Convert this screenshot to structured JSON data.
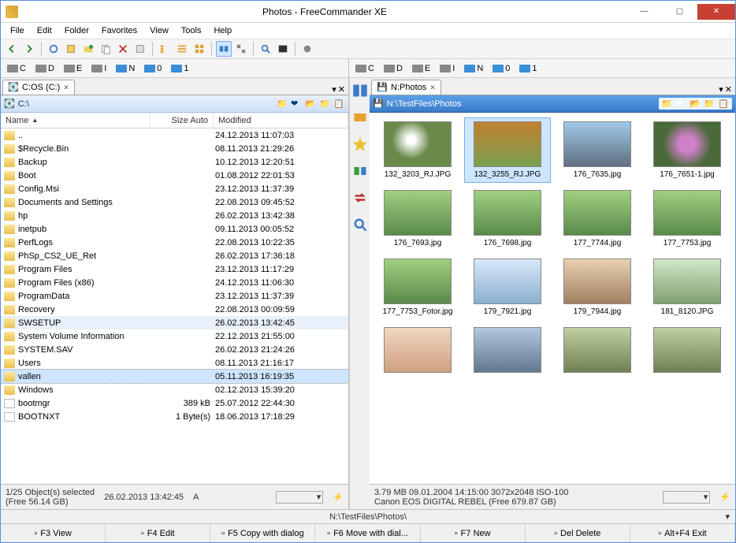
{
  "title": "Photos - FreeCommander XE",
  "menu": [
    "File",
    "Edit",
    "Folder",
    "Favorites",
    "View",
    "Tools",
    "Help"
  ],
  "drives_left": [
    {
      "label": "C",
      "net": false
    },
    {
      "label": "D",
      "net": false
    },
    {
      "label": "E",
      "net": false
    },
    {
      "label": "I",
      "net": false
    },
    {
      "label": "N",
      "net": true
    },
    {
      "label": "0",
      "net": true
    },
    {
      "label": "1",
      "net": true
    }
  ],
  "drives_right": [
    {
      "label": "C",
      "net": false
    },
    {
      "label": "D",
      "net": false
    },
    {
      "label": "E",
      "net": false
    },
    {
      "label": "I",
      "net": false
    },
    {
      "label": "N",
      "net": true
    },
    {
      "label": "0",
      "net": true
    },
    {
      "label": "1",
      "net": true
    }
  ],
  "left": {
    "tab": "C:OS (C:)",
    "path": "C:\\",
    "columns": {
      "name": "Name",
      "size": "Size Auto",
      "modified": "Modified"
    },
    "rows": [
      {
        "icon": "up",
        "name": "..",
        "size": "",
        "mod": "24.12.2013 11:07:03"
      },
      {
        "icon": "folder",
        "name": "$Recycle.Bin",
        "size": "",
        "mod": "08.11.2013 21:29:26"
      },
      {
        "icon": "folder",
        "name": "Backup",
        "size": "",
        "mod": "10.12.2013 12:20:51"
      },
      {
        "icon": "folder",
        "name": "Boot",
        "size": "",
        "mod": "01.08.2012 22:01:53"
      },
      {
        "icon": "folder",
        "name": "Config.Msi",
        "size": "",
        "mod": "23.12.2013 11:37:39"
      },
      {
        "icon": "folder",
        "name": "Documents and Settings",
        "size": "",
        "mod": "22.08.2013 09:45:52"
      },
      {
        "icon": "folder",
        "name": "hp",
        "size": "",
        "mod": "26.02.2013 13:42:38"
      },
      {
        "icon": "folder",
        "name": "inetpub",
        "size": "",
        "mod": "09.11.2013 00:05:52"
      },
      {
        "icon": "folder",
        "name": "PerfLogs",
        "size": "",
        "mod": "22.08.2013 10:22:35"
      },
      {
        "icon": "folder",
        "name": "PhSp_CS2_UE_Ret",
        "size": "",
        "mod": "26.02.2013 17:36:18"
      },
      {
        "icon": "folder",
        "name": "Program Files",
        "size": "",
        "mod": "23.12.2013 11:17:29"
      },
      {
        "icon": "folder",
        "name": "Program Files (x86)",
        "size": "",
        "mod": "24.12.2013 11:06:30"
      },
      {
        "icon": "folder",
        "name": "ProgramData",
        "size": "",
        "mod": "23.12.2013 11:37:39"
      },
      {
        "icon": "folder",
        "name": "Recovery",
        "size": "",
        "mod": "22.08.2013 00:09:59"
      },
      {
        "icon": "folder",
        "name": "SWSETUP",
        "size": "",
        "mod": "26.02.2013 13:42:45",
        "hilite": true
      },
      {
        "icon": "folder",
        "name": "System Volume Information",
        "size": "",
        "mod": "22.12.2013 21:55:00"
      },
      {
        "icon": "folder",
        "name": "SYSTEM.SAV",
        "size": "",
        "mod": "26.02.2013 21:24:26"
      },
      {
        "icon": "folder",
        "name": "Users",
        "size": "",
        "mod": "08.11.2013 21:16:17"
      },
      {
        "icon": "folder",
        "name": "vallen",
        "size": "",
        "mod": "05.11.2013 16:19:35",
        "sel": true
      },
      {
        "icon": "folder",
        "name": "Windows",
        "size": "",
        "mod": "02.12.2013 15:39:20"
      },
      {
        "icon": "file",
        "name": "bootmgr",
        "size": "389 kB",
        "mod": "25.07.2012 22:44:30"
      },
      {
        "icon": "file",
        "name": "BOOTNXT",
        "size": "1 Byte(s)",
        "mod": "18.06.2013 17:18:29"
      }
    ],
    "status1": "1/25 Object(s) selected",
    "status_date": "26.02.2013 13:42:45",
    "status_attr": "A",
    "status2": "(Free 56.14 GB)"
  },
  "right": {
    "tab": "N:Photos",
    "path": "N:\\TestFiles\\Photos",
    "thumbs": [
      {
        "label": "132_3203_RJ.JPG",
        "cls": "tg1"
      },
      {
        "label": "132_3255_RJ.JPG",
        "cls": "tg2",
        "sel": true
      },
      {
        "label": "176_7635.jpg",
        "cls": "tg3"
      },
      {
        "label": "176_7651-1.jpg",
        "cls": "tg4"
      },
      {
        "label": "176_7693.jpg",
        "cls": "tg5"
      },
      {
        "label": "176_7698.jpg",
        "cls": "tg5"
      },
      {
        "label": "177_7744.jpg",
        "cls": "tg5"
      },
      {
        "label": "177_7753.jpg",
        "cls": "tg5"
      },
      {
        "label": "177_7753_Fotor.jpg",
        "cls": "tg5"
      },
      {
        "label": "179_7921.jpg",
        "cls": "tg7"
      },
      {
        "label": "179_7944.jpg",
        "cls": "tg9"
      },
      {
        "label": "181_8120.JPG",
        "cls": "tg10"
      },
      {
        "label": "",
        "cls": "tg11"
      },
      {
        "label": "",
        "cls": "tg12"
      },
      {
        "label": "",
        "cls": "tg8"
      },
      {
        "label": "",
        "cls": "tg8"
      }
    ],
    "status1": "3.79 MB   09.01.2004 14:15:00   3072x2048   ISO-100",
    "status2": "Canon EOS DIGITAL REBEL   (Free 679.87 GB)"
  },
  "bottom_path": "N:\\TestFiles\\Photos\\",
  "fnkeys": [
    {
      "label": "F3 View"
    },
    {
      "label": "F4 Edit"
    },
    {
      "label": "F5 Copy with dialog"
    },
    {
      "label": "F6 Move with dial..."
    },
    {
      "label": "F7 New"
    },
    {
      "label": "Del Delete"
    },
    {
      "label": "Alt+F4 Exit"
    }
  ]
}
